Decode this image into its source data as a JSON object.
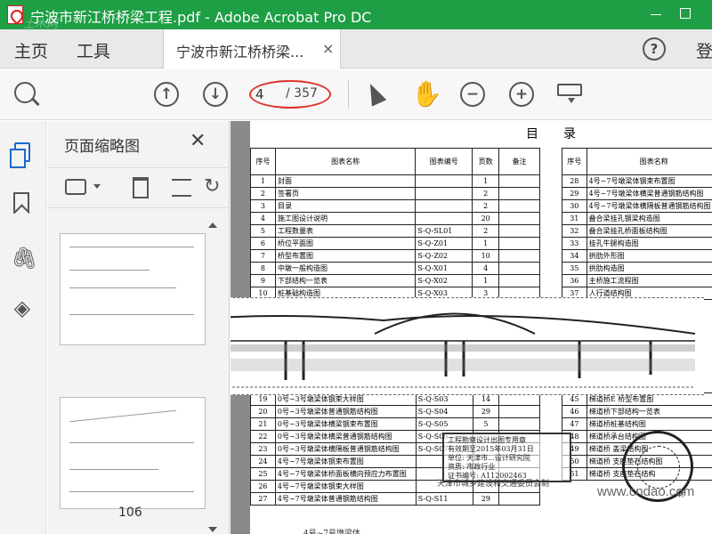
{
  "window": {
    "title": "宁波市新江桥桥梁工程.pdf - Adobe Acrobat Pro DC",
    "logo_watermark": "土木网"
  },
  "tabs": {
    "home": "主页",
    "tools": "工具",
    "document": "宁波市新江桥桥梁...",
    "close": "×",
    "help": "?",
    "signin": "登"
  },
  "toolbar": {
    "current_page": "4",
    "total_pages": "/ 357",
    "prev_page": "↑",
    "next_page": "↓",
    "zoom_out": "−",
    "zoom_in": "+",
    "hand": "✋"
  },
  "panel": {
    "title": "页面缩略图",
    "close": "✕",
    "rotate": "↻",
    "thumb_page_label": "106"
  },
  "rail": {
    "attach": "🖇",
    "layers": "◈"
  },
  "document": {
    "heading": "目录",
    "left_table": {
      "headers": [
        "序号",
        "图表名称",
        "图表编号",
        "页数",
        "备注"
      ],
      "rows": [
        [
          "1",
          "封面",
          "",
          "1",
          ""
        ],
        [
          "2",
          "签署页",
          "",
          "2",
          ""
        ],
        [
          "3",
          "目录",
          "",
          "2",
          ""
        ],
        [
          "4",
          "施工图设计说明",
          "",
          "20",
          ""
        ],
        [
          "5",
          "工程数量表",
          "S-Q-SL01",
          "2",
          ""
        ],
        [
          "6",
          "桥位平面图",
          "S-Q-Z01",
          "1",
          ""
        ],
        [
          "7",
          "桥型布置图",
          "S-Q-Z02",
          "10",
          ""
        ],
        [
          "8",
          "中墩一般构造图",
          "S-Q-X01",
          "4",
          ""
        ],
        [
          "9",
          "下部结构一览表",
          "S-Q-X02",
          "1",
          ""
        ],
        [
          "10",
          "桩基础构造图",
          "S-Q-X03",
          "3",
          ""
        ]
      ],
      "rows_lower": [
        [
          "19",
          "0号~3号墩梁体钢束大样图",
          "S-Q-S03",
          "14",
          ""
        ],
        [
          "20",
          "0号~3号墩梁体普通钢筋结构图",
          "S-Q-S04",
          "29",
          ""
        ],
        [
          "21",
          "0号~3号墩梁体横梁钢束布置图",
          "S-Q-S05",
          "5",
          ""
        ],
        [
          "22",
          "0号~3号墩梁体横梁普通钢筋结构图",
          "S-Q-S06",
          "",
          ""
        ],
        [
          "23",
          "0号~3号墩梁体横隔板普通钢筋结构图",
          "S-Q-S07",
          "",
          ""
        ],
        [
          "24",
          "4号~7号墩梁体钢束布置图",
          "",
          "",
          ""
        ],
        [
          "25",
          "4号~7号墩梁体桥面板横向预应力布置图",
          "",
          "",
          ""
        ],
        [
          "26",
          "4号~7号墩梁体钢束大样图",
          "",
          "",
          ""
        ],
        [
          "27",
          "4号~7号墩梁体普通钢筋结构图",
          "S-Q-S11",
          "29",
          ""
        ]
      ]
    },
    "right_table": {
      "headers": [
        "序号",
        "图表名称"
      ],
      "rows": [
        [
          "28",
          "4号~7号墩梁体钢束布置图"
        ],
        [
          "29",
          "4号~7号墩梁体横梁普通钢筋结构图"
        ],
        [
          "30",
          "4号~7号墩梁体横隔板普通钢筋结构图"
        ],
        [
          "31",
          "叠合梁挂孔钢梁构造图"
        ],
        [
          "32",
          "叠合梁挂孔桥面板结构图"
        ],
        [
          "33",
          "挂孔牛腿构造图"
        ],
        [
          "34",
          "拱肋外形图"
        ],
        [
          "35",
          "拱肋构造图"
        ],
        [
          "36",
          "主桥施工流程图"
        ],
        [
          "37",
          "人行道结构图"
        ]
      ],
      "rows_lower": [
        [
          "45",
          "梯道桥E 桥型布置图"
        ],
        [
          "46",
          "梯道桥下部结构一览表"
        ],
        [
          "47",
          "梯道桥桩基结构图"
        ],
        [
          "48",
          "梯道桥承台结构图"
        ],
        [
          "49",
          "梯道桥 盖梁结构图"
        ],
        [
          "50",
          "梯道桥 支座垫石结构图"
        ],
        [
          "51",
          "梯道桥 支座垫石结构"
        ]
      ]
    },
    "stamp_lines": [
      "工程勘察设计出图专用章",
      "有效期至2015年03月31日",
      "单位: 天津市...设计研究院",
      "资质: 市政行业",
      "证书编号: A112002463",
      "天津市城乡建设和交通委员会制"
    ],
    "watermark": "www.cndao.com",
    "footer_fragment": "计",
    "bottom_fragment": "4号~7号墩梁体..."
  }
}
